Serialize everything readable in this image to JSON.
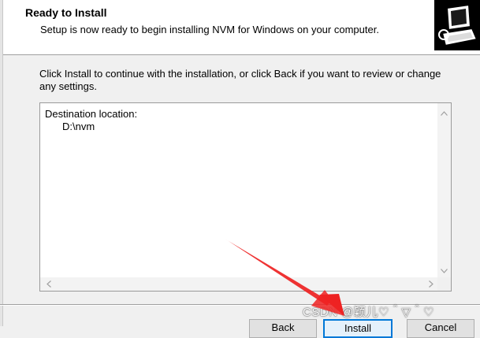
{
  "header": {
    "title": "Ready to Install",
    "subtitle": "Setup is now ready to begin installing NVM for Windows on your computer."
  },
  "main": {
    "intro": "Click Install to continue with the installation, or click Back if you want to review or change any settings.",
    "memo": {
      "heading": "Destination location:",
      "value": "D:\\nvm"
    }
  },
  "buttons": {
    "back": "Back",
    "install": "Install",
    "cancel": "Cancel"
  },
  "watermark": "CSDN @颖儿♡＾▽＾♡",
  "colors": {
    "annotation_arrow": "#ee2222",
    "focus_border": "#0078d7"
  }
}
